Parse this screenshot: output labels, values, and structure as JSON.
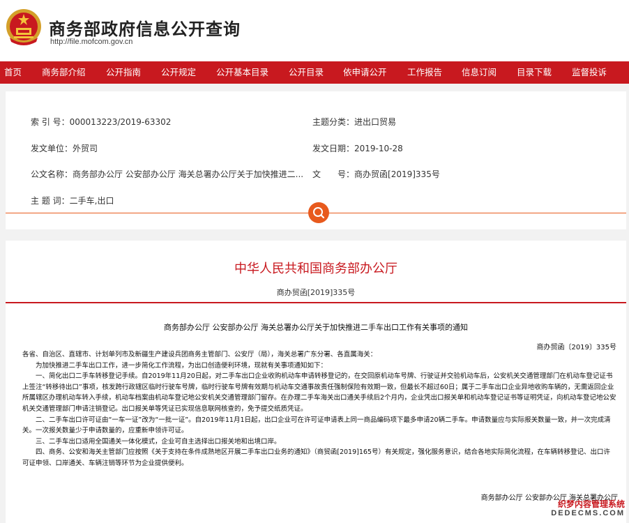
{
  "header": {
    "title": "商务部政府信息公开查询",
    "url": "http://file.mofcom.gov.cn"
  },
  "nav": [
    "首页",
    "商务部介绍",
    "公开指南",
    "公开规定",
    "公开基本目录",
    "公开目录",
    "依申请公开",
    "工作报告",
    "信息订阅",
    "目录下载",
    "监督投诉"
  ],
  "meta": {
    "index_label": "索 引 号：",
    "index_value": "000013223/2019-63302",
    "category_label": "主题分类：",
    "category_value": "进出口贸易",
    "unit_label": "发文单位：",
    "unit_value": "外贸司",
    "date_label": "发文日期：",
    "date_value": "2019-10-28",
    "name_label": "公文名称：",
    "name_value": "商务部办公厅 公安部办公厅 海关总署办公厅关于加快推进二...",
    "docno_label": "文　　号：",
    "docno_value": "商办贸函[2019]335号",
    "keywords_label": "主 题 词：",
    "keywords_value": "二手车,出口"
  },
  "doc": {
    "org": "中华人民共和国商务部办公厅",
    "number": "商办贸函[2019]335号",
    "title": "商务部办公厅 公安部办公厅 海关总署办公厅关于加快推进二手车出口工作有关事项的通知",
    "number2": "商办贸函〔2019〕335号",
    "paragraphs": [
      "各省、自治区、直辖市、计划单列市及新疆生产建设兵团商务主管部门、公安厅（局），海关总署广东分署、各直属海关：",
      "　　为加快推进二手车出口工作，进一步简化工作流程，为出口创造便利环境，现就有关事项通知如下：",
      "　　一、简化出口二手车转移登记手续。自2019年11月20日起，对二手车出口企业收购机动车申请转移登记的，在交回原机动车号牌、行驶证并交验机动车后，公安机关交通管理部门在机动车登记证书上签注“转移待出口”事项，核发跨行政辖区临时行驶车号牌，临时行驶车号牌有效期与机动车交通事故责任强制保险有效期一致，但最长不超过60日；属于二手车出口企业异地收购车辆的，无需返回企业所属辖区办理机动车转入手续，机动车档案由机动车登记地公安机关交通管理部门留存。在办理二手车海关出口通关手续后2个月内，企业凭出口报关单和机动车登记证书等证明凭证，向机动车登记地公安机关交通管理部门申请注销登记。出口报关单等凭证已实现信息联网核查的，免予提交纸质凭证。",
      "　　二、二手车出口许可证由“一车一证”改为“一批一证”。自2019年11月1日起，出口企业可在许可证申请表上同一商品编码项下最多申请20辆二手车。申请数量应与实际报关数量一致，并一次完成清关。一次报关数量少于申请数量的，应重新申领许可证。",
      "　　三、二手车出口适用全国通关一体化模式，企业可自主选择出口报关地和出境口岸。",
      "　　四、商务、公安和海关主管部门应按照《关于支持在条件成熟地区开展二手车出口业务的通知》（商贸函[2019]165号）有关规定，强化服务意识，结合各地实际简化流程，在车辆转移登记、出口许可证申领、口岸通关、车辆注销等环节为企业提供便利。"
    ],
    "signature": "商务部办公厅  公安部办公厅  海关总署办公厅"
  },
  "watermark": {
    "line1": "织梦内容管理系统",
    "line2": "DEDECMS.COM"
  },
  "colors": {
    "nav_bg": "#c8191f",
    "accent": "#e85a1d",
    "title_red": "#c8191f"
  }
}
